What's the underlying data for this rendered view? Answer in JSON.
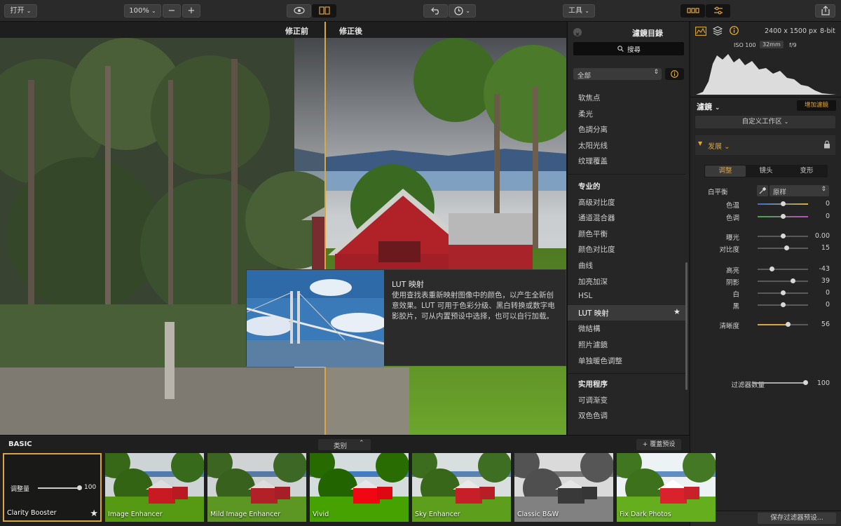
{
  "toolbar": {
    "open_label": "打开",
    "zoom_value": "100%",
    "zoom_out": "−",
    "zoom_in": "+",
    "tools_label": "工具"
  },
  "compare": {
    "before_label": "修正前",
    "after_label": "修正後"
  },
  "tooltip": {
    "title": "LUT 映射",
    "body": "使用查找表重新映射图像中的颜色，以产生全新创意效果。LUT 可用于色彩分级、黑白转换或数字电影胶片，可从内置预设中选择，也可以自行加载。"
  },
  "catalog": {
    "title": "濾鏡目錄",
    "search_label": "搜尋",
    "category_selected": "全部",
    "items_group1": [
      "软焦点",
      "柔光",
      "色調分离",
      "太阳光线",
      "纹理覆盖"
    ],
    "group2_title": "专业的",
    "items_group2": [
      "高级对比度",
      "通道混合器",
      "颜色平衡",
      "颜色对比度",
      "曲线",
      "加亮加深",
      "HSL",
      "LUT 映射",
      "微結構",
      "照片濾鏡",
      "单独暖色调整"
    ],
    "group3_title": "实用程序",
    "items_group3": [
      "可调渐变",
      "双色色调"
    ]
  },
  "info": {
    "dimensions": "2400 x 1500 px",
    "bit_depth": "8-bit",
    "iso": "ISO 100",
    "focal": "32mm",
    "aperture": "f/9"
  },
  "panel": {
    "filters_label": "濾鏡",
    "add_filter_label": "增加濾鏡",
    "workspace_label": "自定义工作区",
    "section_label": "发展",
    "tabs": [
      "调整",
      "镜头",
      "变形"
    ],
    "wb_label": "白平衡",
    "wb_value": "原样",
    "sliders": [
      {
        "label": "色温",
        "value": "0",
        "pos": 0.5,
        "type": "temp"
      },
      {
        "label": "色调",
        "value": "0",
        "pos": 0.5,
        "type": "tint"
      },
      {
        "label": "曝光",
        "value": "0.00",
        "pos": 0.5,
        "type": "plain"
      },
      {
        "label": "对比度",
        "value": "15",
        "pos": 0.58,
        "type": "plain"
      },
      {
        "label": "高亮",
        "value": "-43",
        "pos": 0.28,
        "type": "plain"
      },
      {
        "label": "阴影",
        "value": "39",
        "pos": 0.7,
        "type": "plain"
      },
      {
        "label": "白",
        "value": "0",
        "pos": 0.5,
        "type": "plain"
      },
      {
        "label": "黑",
        "value": "0",
        "pos": 0.5,
        "type": "plain"
      },
      {
        "label": "清晰度",
        "value": "56",
        "pos": 0.6,
        "type": "accent"
      }
    ],
    "amount_label": "过滤器数量",
    "amount_value": "100",
    "amount_pos": 1.0,
    "save_preset_label": "保存过滤器预设..."
  },
  "presets": {
    "group_label": "BASIC",
    "category_label": "类别",
    "overlay_label": "+ 覆蓋預设",
    "amount_label": "调整量",
    "amount_value": "100",
    "items": [
      "Clarity Booster",
      "Image Enhancer",
      "Mild Image Enhancer",
      "Vivid",
      "Sky Enhancer",
      "Classic B&W",
      "Fix Dark Photos"
    ]
  },
  "colors": {
    "accent": "#e0a53a",
    "info_icon": "#f0b030"
  }
}
